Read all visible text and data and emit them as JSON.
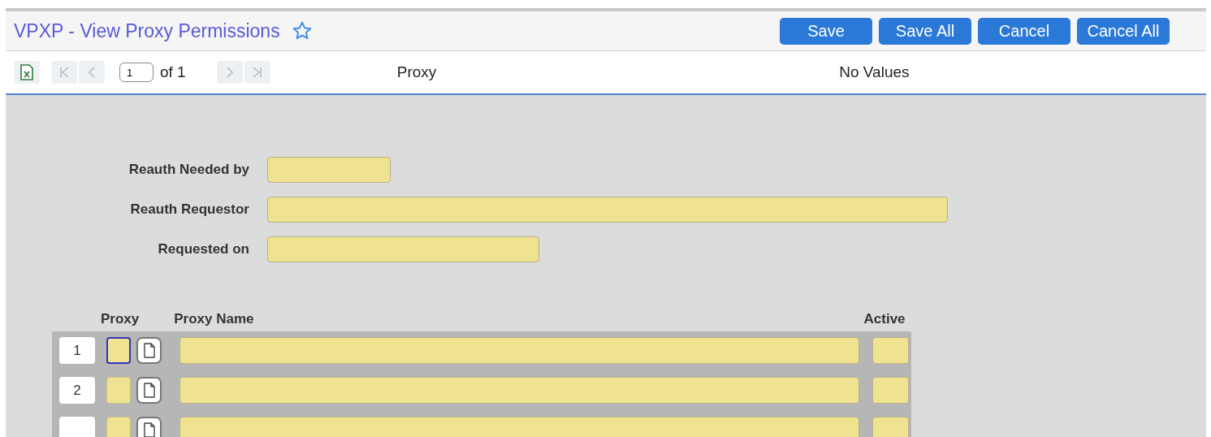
{
  "header": {
    "title": "VPXP - View Proxy Permissions",
    "favorite": false,
    "buttons": [
      "Save",
      "Save All",
      "Cancel",
      "Cancel All"
    ]
  },
  "toolbar": {
    "page": "1",
    "of": "of 1",
    "block": "Proxy",
    "status": "No Values"
  },
  "form": {
    "fields": [
      {
        "label": "Reauth Needed by"
      },
      {
        "label": "Reauth Requestor"
      },
      {
        "label": "Requested on"
      }
    ]
  },
  "grid": {
    "columns": [
      "Proxy",
      "Proxy Name",
      "Active"
    ],
    "rows": [
      {
        "number": "1",
        "focused": true
      },
      {
        "number": "2",
        "focused": false
      },
      {
        "focused": false
      }
    ]
  }
}
